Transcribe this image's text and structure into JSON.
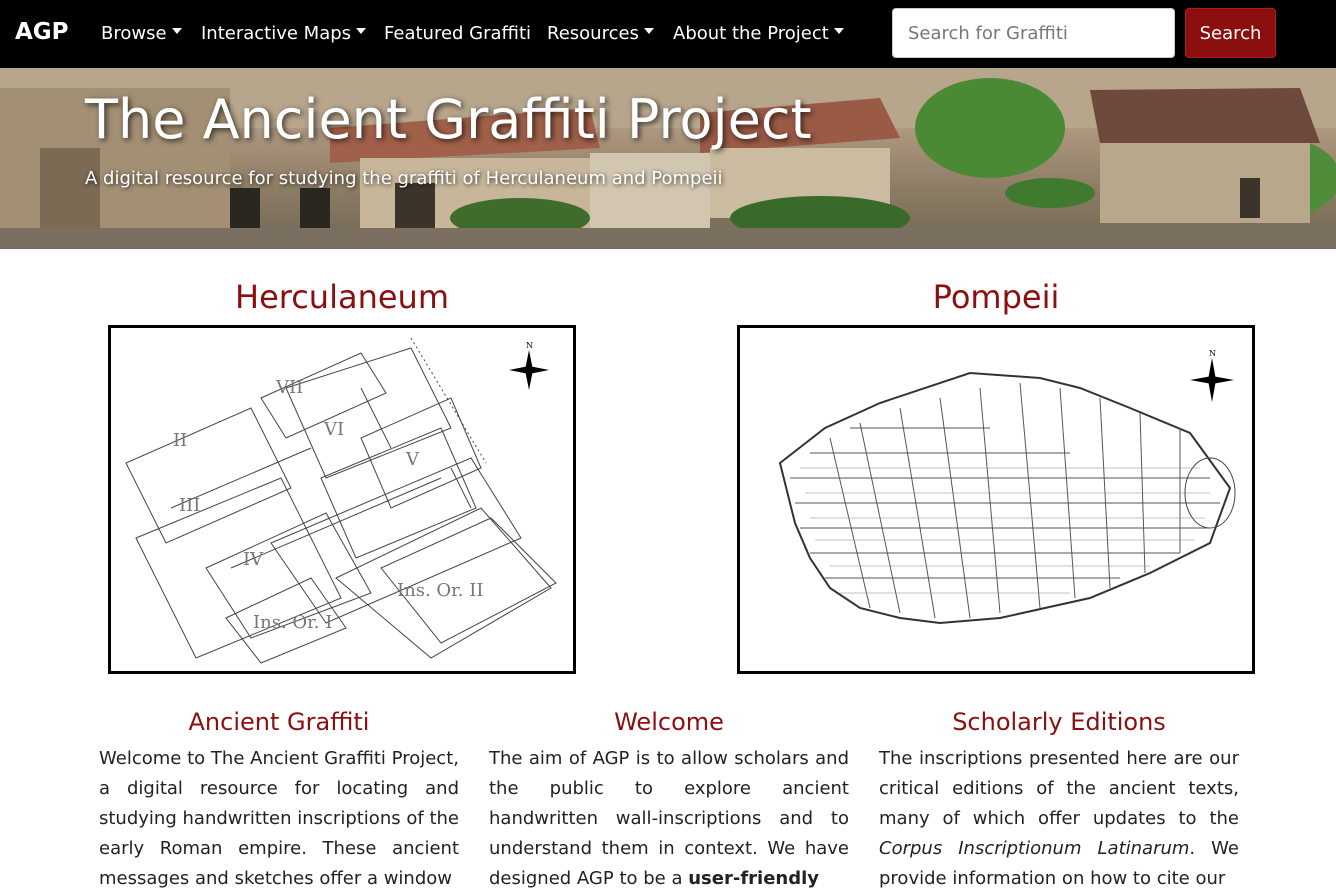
{
  "nav": {
    "brand": "AGP",
    "items": [
      {
        "label": "Browse",
        "dropdown": true
      },
      {
        "label": "Interactive Maps",
        "dropdown": true
      },
      {
        "label": "Featured Graffiti",
        "dropdown": false
      },
      {
        "label": "Resources",
        "dropdown": true
      },
      {
        "label": "About the Project",
        "dropdown": true
      }
    ],
    "search_placeholder": "Search for Graffiti",
    "search_button": "Search"
  },
  "hero": {
    "title": "The Ancient Graffiti Project",
    "subtitle": "A digital resource for studying the graffiti of Herculaneum and Pompeii"
  },
  "maps": {
    "herculaneum": {
      "title": "Herculaneum",
      "labels": [
        "II",
        "III",
        "IV",
        "V",
        "VI",
        "VII",
        "Ins. Or. I",
        "Ins. Or. II"
      ],
      "north": "N"
    },
    "pompeii": {
      "title": "Pompeii",
      "north": "N"
    }
  },
  "columns": {
    "ancient": {
      "title": "Ancient Graffiti",
      "text": "Welcome to The Ancient Graffiti Project, a digital resource for locating and studying handwritten inscriptions of the early Roman empire. These ancient messages and sketches offer a window"
    },
    "welcome": {
      "title": "Welcome",
      "text_before": "The aim of AGP is to allow scholars and the public to explore ancient handwritten wall-inscriptions and to understand them in context. We have designed AGP to be a ",
      "text_bold": "user-friendly"
    },
    "scholarly": {
      "title": "Scholarly Editions",
      "text_before": "The inscriptions presented here are our critical editions of the ancient texts, many of which offer updates to the ",
      "text_italic": "Corpus Inscriptionum Latinarum",
      "text_after": ". We provide information on how to cite our"
    }
  },
  "colors": {
    "navbar": "#000000",
    "accent": "#8b0f0f"
  }
}
